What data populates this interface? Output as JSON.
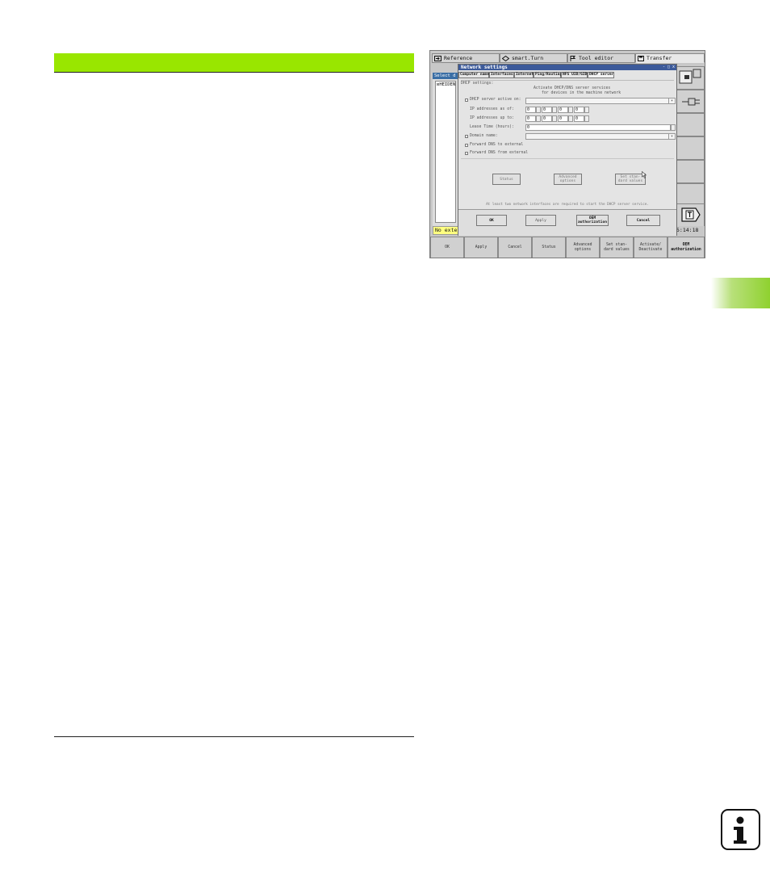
{
  "page": {
    "accent_color": "#99e600",
    "side_tab_color": "#8fd12f"
  },
  "tabs": [
    {
      "label": "Reference",
      "icon": "arrow-right-box-icon"
    },
    {
      "label": "smart.Turn",
      "icon": "diamond-arrow-icon"
    },
    {
      "label": "Tool editor",
      "icon": "flag-icon"
    },
    {
      "label": "Transfer",
      "icon": "floppy-disk-icon"
    }
  ],
  "left_panel": {
    "title": "Select d",
    "tree_item": "HEIDEN"
  },
  "status": {
    "message": "No exte",
    "clock": "5:14:18"
  },
  "dialog": {
    "title": "Network settings",
    "title_buttons": "- □ x",
    "tabs": [
      "Computer name",
      "Interfaces",
      "Internet",
      "Ping/Routing",
      "NFS UID/GID",
      "DHCP server"
    ],
    "group_label": "DHCP settings:",
    "description_line1": "Activate DHCP/DNS server services",
    "description_line2": "for devices in the machine network",
    "server_active_label": "DHCP server active on:",
    "ip_from_label": "IP addresses as of:",
    "ip_to_label": "IP addresses up to:",
    "ip_from": [
      "0",
      "0",
      "0",
      "0"
    ],
    "ip_to": [
      "0",
      "0",
      "0",
      "0"
    ],
    "lease_label": "Lease Time (hours):",
    "lease_value": "0",
    "domain_label": "Domain name:",
    "forward_dns_label": "Forward DNS to external",
    "forward_dns_from_label": "Forward DNS from external",
    "btn_status": "Status",
    "btn_advanced": "Advanced\noptions",
    "btn_standard": "Set stan-\ndard values",
    "note": "At least two network interfaces are required to start the DHCP server service.",
    "btn_ok": "OK",
    "btn_apply": "Apply",
    "btn_oem": "OEM\nauthorization",
    "btn_cancel": "Cancel"
  },
  "softkeys": [
    "OK",
    "Apply",
    "Cancel",
    "Status",
    "Advanced\noptions",
    "Set stan-\ndard values",
    "Activate/\nDeactivate",
    "OEM\nauthorization"
  ]
}
